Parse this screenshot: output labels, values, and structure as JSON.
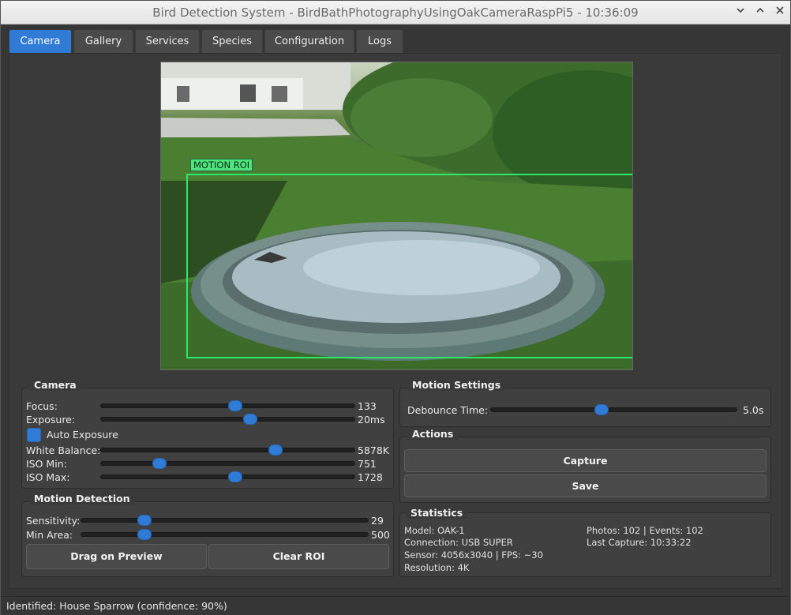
{
  "window": {
    "title": "Bird Detection System - BirdBathPhotographyUsingOakCameraRaspPi5 - 10:36:09",
    "controls": [
      "chevron-down-icon",
      "chevron-up-icon",
      "close-icon"
    ]
  },
  "tabs": [
    {
      "label": "Camera",
      "active": true
    },
    {
      "label": "Gallery",
      "active": false
    },
    {
      "label": "Services",
      "active": false
    },
    {
      "label": "Species",
      "active": false
    },
    {
      "label": "Configuration",
      "active": false
    },
    {
      "label": "Logs",
      "active": false
    }
  ],
  "preview": {
    "roi_label": "MOTION ROI",
    "roi_color": "#2ee86e"
  },
  "camera": {
    "title": "Camera",
    "focus": {
      "label": "Focus:",
      "value": "133",
      "level": 0.53
    },
    "exposure": {
      "label": "Exposure:",
      "value": "20ms",
      "level": 0.59
    },
    "auto_exposure": {
      "label": "Auto Exposure",
      "checked": true
    },
    "white_balance": {
      "label": "White Balance:",
      "value": "5878K",
      "level": 0.69
    },
    "iso_min": {
      "label": "ISO Min:",
      "value": "751",
      "level": 0.23
    },
    "iso_max": {
      "label": "ISO Max:",
      "value": "1728",
      "level": 0.53
    }
  },
  "motion_detection": {
    "title": "Motion Detection",
    "sensitivity": {
      "label": "Sensitivity:",
      "value": "29",
      "level": 0.22
    },
    "min_area": {
      "label": "Min Area:",
      "value": "500",
      "level": 0.22
    },
    "drag_button": "Drag on Preview",
    "clear_button": "Clear ROI"
  },
  "motion_settings": {
    "title": "Motion Settings",
    "debounce": {
      "label": "Debounce Time:",
      "value": "5.0s",
      "level": 0.45
    }
  },
  "actions": {
    "title": "Actions",
    "capture": "Capture",
    "save": "Save"
  },
  "statistics": {
    "title": "Statistics",
    "model": "Model: OAK-1",
    "connection": "Connection: USB SUPER",
    "sensor": "Sensor: 4056x3040 | FPS: ~30",
    "resolution": "Resolution: 4K",
    "photos_events": "Photos: 102 | Events: 102",
    "last_capture": "Last Capture: 10:33:22"
  },
  "status": {
    "text": "Identified: House Sparrow (confidence: 90%)"
  },
  "colors": {
    "accent": "#2f7bd6",
    "roi": "#2ee86e"
  }
}
